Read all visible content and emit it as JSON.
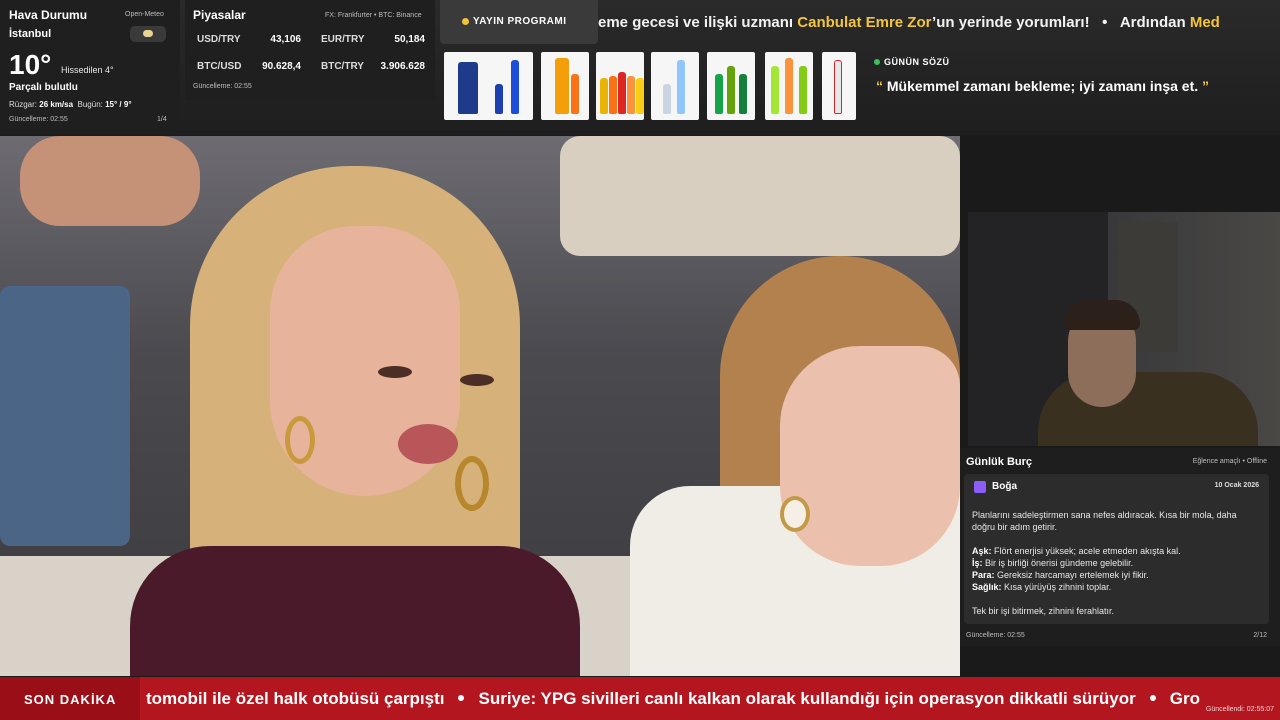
{
  "weather": {
    "title": "Hava Durumu",
    "source": "Open-Meteo",
    "city": "İstanbul",
    "temperature": "10°",
    "feels_like": "Hissedilen 4°",
    "condition": "Parçalı bulutlu",
    "wind_label": "Rüzgar:",
    "wind_value": "26 km/sa",
    "today_label": "Bugün:",
    "today_value": "15° / 9°",
    "updated": "Güncelleme: 02:55",
    "page": "1/4",
    "icon": "partly-cloudy-icon"
  },
  "markets": {
    "title": "Piyasalar",
    "source": "FX: Frankfurter • BTC: Binance",
    "items": [
      {
        "name": "USD/TRY",
        "value": "43,106"
      },
      {
        "name": "EUR/TRY",
        "value": "50,184"
      },
      {
        "name": "BTC/USD",
        "value": "90.628,4"
      },
      {
        "name": "BTC/TRY",
        "value": "3.906.628"
      }
    ],
    "updated": "Güncelleme: 02:55"
  },
  "tv_guide": {
    "label": "YAYIN PROGRAMI"
  },
  "headline": {
    "prefix": "eme gecesi ve ilişki uzmanı ",
    "highlight": "Canbulat Emre Zor",
    "suffix": "’un yerinde yorumları!",
    "next": "Ardından ",
    "next_highlight": "Med"
  },
  "quote": {
    "title": "GÜNÜN SÖZÜ",
    "text": "Mükemmel zamanı bekleme; iyi zamanı inşa et.",
    "open_mark": "“",
    "close_mark": "”"
  },
  "horoscope": {
    "title": "Günlük Burç",
    "tag": "Eğlence amaçlı • Offline",
    "sign": "Boğa",
    "date": "10 Ocak 2026",
    "intro": "Planlarını sadeleştirmen sana nefes aldıracak. Kısa bir mola, daha doğru bir adım getirir.",
    "love_label": "Aşk:",
    "love": "Flört enerjisi yüksek; acele etmeden akışta kal.",
    "work_label": "İş:",
    "work": "Bir iş birliği önerisi gündeme gelebilir.",
    "money_label": "Para:",
    "money": "Gereksiz harcamayı ertelemek iyi fikir.",
    "health_label": "Sağlık:",
    "health": "Kısa yürüyüş zihnini toplar.",
    "closing": "Tek bir işi bitirmek, zihnini ferahlatır.",
    "updated": "Güncelleme: 02:55",
    "page": "2/12"
  },
  "ticker": {
    "label": "SON DAKİKA",
    "item1": "tomobil ile özel halk otobüsü çarpıştı",
    "item2": "Suriye: YPG sivilleri canlı kalkan olarak kullandığı için operasyon dikkatli sürüyor",
    "item3": "Gro",
    "updated": "Güncellendi: 02:55:07",
    "color": "#b41620"
  }
}
